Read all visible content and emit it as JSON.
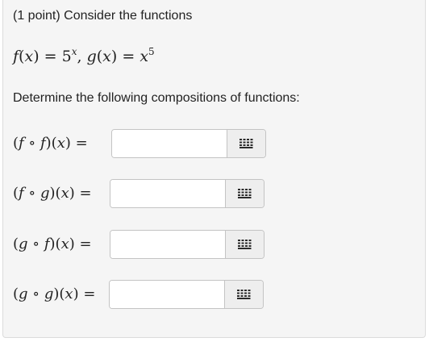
{
  "problem": {
    "intro": "(1 point) Consider the functions",
    "definitions": {
      "f_name": "f",
      "g_name": "g",
      "var": "x",
      "f_base": "5",
      "f_exponent": "x",
      "g_base": "x",
      "g_exponent": "5"
    },
    "instructions": "Determine the following compositions of functions:"
  },
  "answers": [
    {
      "outer": "f",
      "inner": "f",
      "var": "x",
      "value": ""
    },
    {
      "outer": "f",
      "inner": "g",
      "var": "x",
      "value": ""
    },
    {
      "outer": "g",
      "inner": "f",
      "var": "x",
      "value": ""
    },
    {
      "outer": "g",
      "inner": "g",
      "var": "x",
      "value": ""
    }
  ],
  "icons": {
    "keypad": "keypad-grid-icon"
  },
  "colors": {
    "card_background": "#f5f5f5",
    "card_border": "#dcdcdc",
    "text": "#222222",
    "input_border": "#c4c4c4",
    "keypad_background": "#eeeeee",
    "keypad_icon": "#2b2b2b"
  }
}
